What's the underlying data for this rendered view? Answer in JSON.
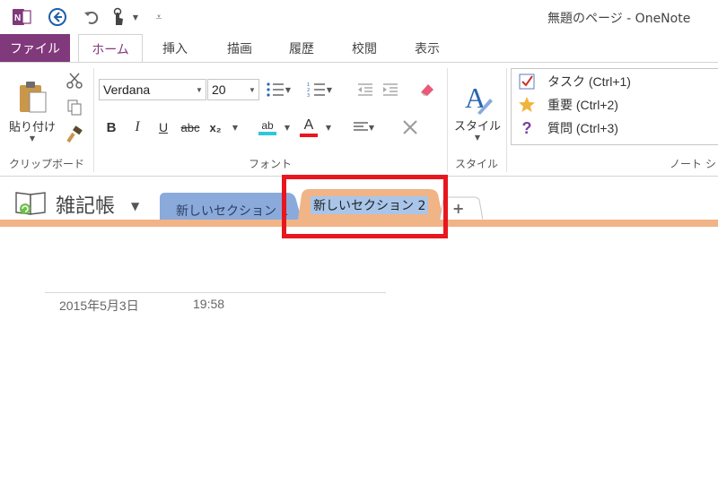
{
  "window": {
    "title": "無題のページ - OneNote"
  },
  "ribbon_tabs": [
    "ファイル",
    "ホーム",
    "挿入",
    "描画",
    "履歴",
    "校閲",
    "表示"
  ],
  "clipboard": {
    "paste_label": "貼り付け",
    "group_label": "クリップボード"
  },
  "font": {
    "family": "Verdana",
    "size": "20",
    "group_label": "フォント",
    "bold": "B",
    "italic": "I",
    "underline": "U",
    "strike": "abc",
    "subscript": "x₂",
    "highlight_glyph": "ab",
    "fontcolor_glyph": "A"
  },
  "styles": {
    "label": "スタイル",
    "group_label": "スタイル"
  },
  "tags": {
    "items": [
      {
        "label": "タスク (Ctrl+1)",
        "icon": "checkbox-icon"
      },
      {
        "label": "重要 (Ctrl+2)",
        "icon": "star-icon"
      },
      {
        "label": "質問 (Ctrl+3)",
        "icon": "question-icon"
      }
    ],
    "group_label": "ノート シ"
  },
  "notebook": {
    "name": "雑記帳"
  },
  "sections": [
    {
      "label": "新しいセクション 1",
      "color": "#8aaadc"
    },
    {
      "label": "新しいセクション 2",
      "color": "#f0b486"
    }
  ],
  "add_section_label": "+",
  "page": {
    "date": "2015年5月3日",
    "time": "19:58"
  },
  "colors": {
    "accent": "#80397b",
    "highlight_box": "#e8161e",
    "section_orange": "#f0b486",
    "section_blue": "#8aaadc"
  }
}
